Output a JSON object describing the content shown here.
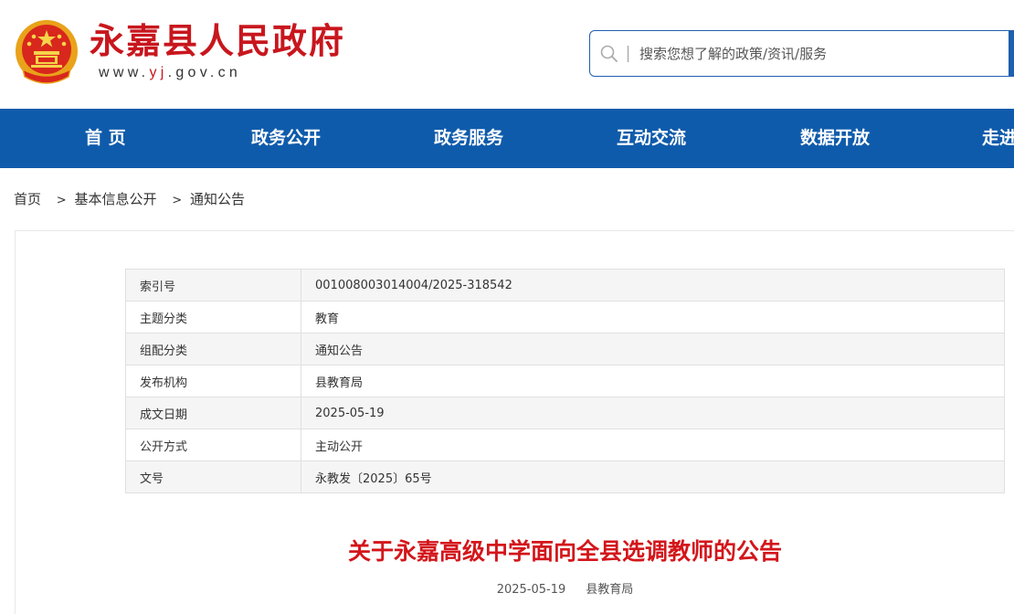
{
  "header": {
    "site_title": "永嘉县人民政府",
    "site_url_prefix": "www.",
    "site_url_highlight": "yj",
    "site_url_suffix": ".gov.cn",
    "emblem_icon": "national-emblem-icon",
    "brand_red": "#c8161d"
  },
  "search": {
    "placeholder": "搜索您想了解的政策/资讯/服务",
    "value": ""
  },
  "nav": {
    "color": "#0f5bab",
    "items": [
      "首 页",
      "政务公开",
      "政务服务",
      "互动交流",
      "数据开放",
      "走进"
    ]
  },
  "breadcrumb": {
    "items": [
      "首页",
      "基本信息公开",
      "通知公告"
    ],
    "separator": ">"
  },
  "meta": {
    "rows": [
      {
        "key": "索引号",
        "value": "001008003014004/2025-318542"
      },
      {
        "key": "主题分类",
        "value": "教育"
      },
      {
        "key": "组配分类",
        "value": "通知公告"
      },
      {
        "key": "发布机构",
        "value": "县教育局"
      },
      {
        "key": "成文日期",
        "value": "2025-05-19"
      },
      {
        "key": "公开方式",
        "value": "主动公开"
      },
      {
        "key": "文号",
        "value": "永教发〔2025〕65号"
      }
    ]
  },
  "article": {
    "title": "关于永嘉高级中学面向全县选调教师的公告",
    "date": "2025-05-19",
    "source": "县教育局"
  }
}
